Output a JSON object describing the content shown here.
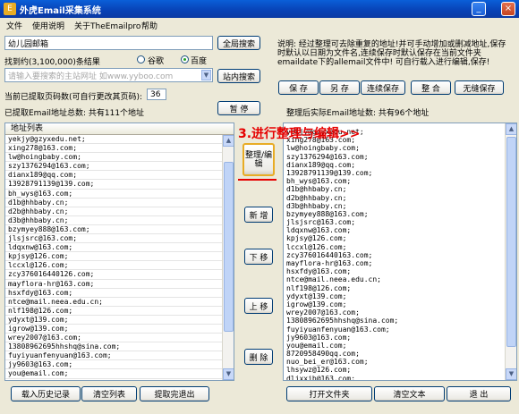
{
  "window": {
    "title": "外虎Email采集系统",
    "app_icon_glyph": "E"
  },
  "menu": [
    "文件",
    "使用说明",
    "关于TheEmailpro",
    "帮助"
  ],
  "search": {
    "keyword": "幼儿园邮箱",
    "global_search": "全局搜索",
    "range_label": "找到约(3,100,000)条结果",
    "engine_google": "谷歌",
    "engine_baidu": "百度",
    "url_placeholder": "请输入要搜索的主站网址 如www.yyboo.com",
    "site_search": "站内搜索"
  },
  "pages": {
    "label": "当前已提取页码数(可自行更改其页码):",
    "value": "36"
  },
  "stats": {
    "extracted": "已提取Email地址总数: 共有111个地址",
    "pause": "暂 停",
    "cleaned": "整理后实际Email地址数: 共有96个地址"
  },
  "desc": [
    "说明: 经过整理可去除重复的地址!并可手动增加或删减地址,保存",
    "时默认以日期为文件名,连续保存时默认保存在当前文件夹",
    "emaildate下的allemail文件中! 可自行载入进行编辑,保存!"
  ],
  "save_buttons": [
    "保 存",
    "另 存",
    "连续保存",
    "整 合",
    "无缝保存"
  ],
  "list_header": "地址列表",
  "annotation": "3.进行整理与编辑>>",
  "mid_buttons": {
    "edit": "整理/编辑",
    "add": "新 增",
    "down": "下 移",
    "up": "上 移",
    "delete": "删 除"
  },
  "left_emails": [
    "yekjy@gzyxedu.net;",
    "xing278@163.com;",
    "lw@hoingbaby.com;",
    "szy1376294@163.com;",
    "dianx189@qq.com;",
    "13928791139@139.com;",
    "bh_wys@163.com;",
    "d1b@hhbaby.cn;",
    "d2b@hhbaby.cn;",
    "d3b@hhbaby.cn;",
    "bzymyey888@163.com;",
    "jlsjsrc@163.com;",
    "ldqxnw@163.com;",
    "kpjsy@126.com;",
    "lccxl@126.com;",
    "zcy376016440126.com;",
    "mayflora-hr@163.com;",
    "hsxfdy@163.com;",
    "ntce@mail.neea.edu.cn;",
    "nlf198@126.com;",
    "ydyxt@139.com;",
    "igrow@139.com;",
    "wrey2007@163.com;",
    "13808962695hhshq@sina.com;",
    "fuyiyuanfenyuan@163.com;",
    "jy9603@163.com;",
    "you@email.com;"
  ],
  "right_emails": [
    "yekjy@gzyxedu.net;",
    "xing278@163.com;",
    "lw@hoingbaby.com;",
    "szy1376294@163.com;",
    "dianx189@qq.com;",
    "13928791139@139.com;",
    "bh_wys@163.com;",
    "d1b@hhbaby.cn;",
    "d2b@hhbaby.cn;",
    "d3b@hhbaby.cn;",
    "bzymyey888@163.com;",
    "jlsjsrc@163.com;",
    "ldqxnw@163.com;",
    "kpjsy@126.com;",
    "lccxl@126.com;",
    "zcy376016440163.com;",
    "mayflora-hr@163.com;",
    "hsxfdy@163.com;",
    "ntce@mail.neea.edu.cn;",
    "nlf198@126.com;",
    "ydyxt@139.com;",
    "igrow@139.com;",
    "wrey2007@163.com;",
    "13808962695hhshq@sina.com;",
    "fuyiyuanfenyuan@163.com;",
    "jy9603@163.com;",
    "you@email.com;",
    "8720958490qq.com;",
    "nuo_bei_er@163.com;",
    "lhsywz@126.com;",
    "dljxxjb@163.com;"
  ],
  "bottom_left": [
    "载入历史记录",
    "清空列表",
    "提取完退出"
  ],
  "bottom_right": [
    "打开文件夹",
    "清空文本",
    "退 出"
  ]
}
